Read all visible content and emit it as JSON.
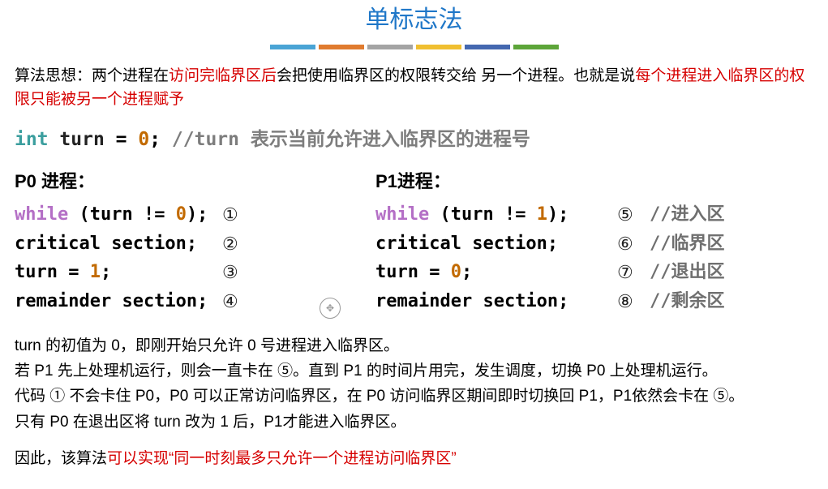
{
  "title": "单标志法",
  "underline_colors": [
    "#4aa4d5",
    "#e07b2f",
    "#a4a4a4",
    "#f0bf30",
    "#4468b0",
    "#5da539"
  ],
  "idea": {
    "p1a": "算法思想：两个进程在",
    "p1b": "访问完临界区后",
    "p1c": "会把使用临界区的权限转交给 另一个进程。也就是说",
    "p1d": "每个进程进入临界区的权限只能被另一个进程赋予"
  },
  "decl": {
    "int": "int",
    "var": "turn",
    "eq": " = ",
    "num": "0",
    "semi": ";",
    "cmt": " //turn 表示当前允许进入临界区的进程号"
  },
  "p0": {
    "title": "P0 进程：",
    "lines": [
      {
        "pre": "while",
        "mid": " (turn != ",
        "num": "0",
        "post": ");",
        "n": "①"
      },
      {
        "plain": "critical section;",
        "n": "②"
      },
      {
        "plain": "turn = ",
        "num": "1",
        "post": ";",
        "n": "③"
      },
      {
        "plain": "remainder section;",
        "n": "④"
      }
    ]
  },
  "p1": {
    "title": "P1进程：",
    "lines": [
      {
        "pre": "while",
        "mid": " (turn != ",
        "num": "1",
        "post": ");",
        "n": "⑤",
        "c": "//进入区"
      },
      {
        "plain": "critical section;",
        "n": "⑥",
        "c": "//临界区"
      },
      {
        "plain": "turn = ",
        "num": "0",
        "post": ";",
        "n": "⑦",
        "c": "//退出区"
      },
      {
        "plain": "remainder section;",
        "n": "⑧",
        "c": "//剩余区"
      }
    ]
  },
  "explain": {
    "l1": "turn 的初值为 0，即刚开始只允许 0 号进程进入临界区。",
    "l2": "若 P1 先上处理机运行，则会一直卡在 ⑤。直到 P1 的时间片用完，发生调度，切换 P0 上处理机运行。",
    "l3": "代码 ① 不会卡住 P0，P0 可以正常访问临界区，在 P0 访问临界区期间即时切换回 P1，P1依然会卡在 ⑤。",
    "l4": "只有 P0 在退出区将 turn 改为 1 后，P1才能进入临界区。",
    "l5a": "因此，该算法",
    "l5b": "可以实现“同一时刻最多只允许一个进程访问临界区”"
  }
}
